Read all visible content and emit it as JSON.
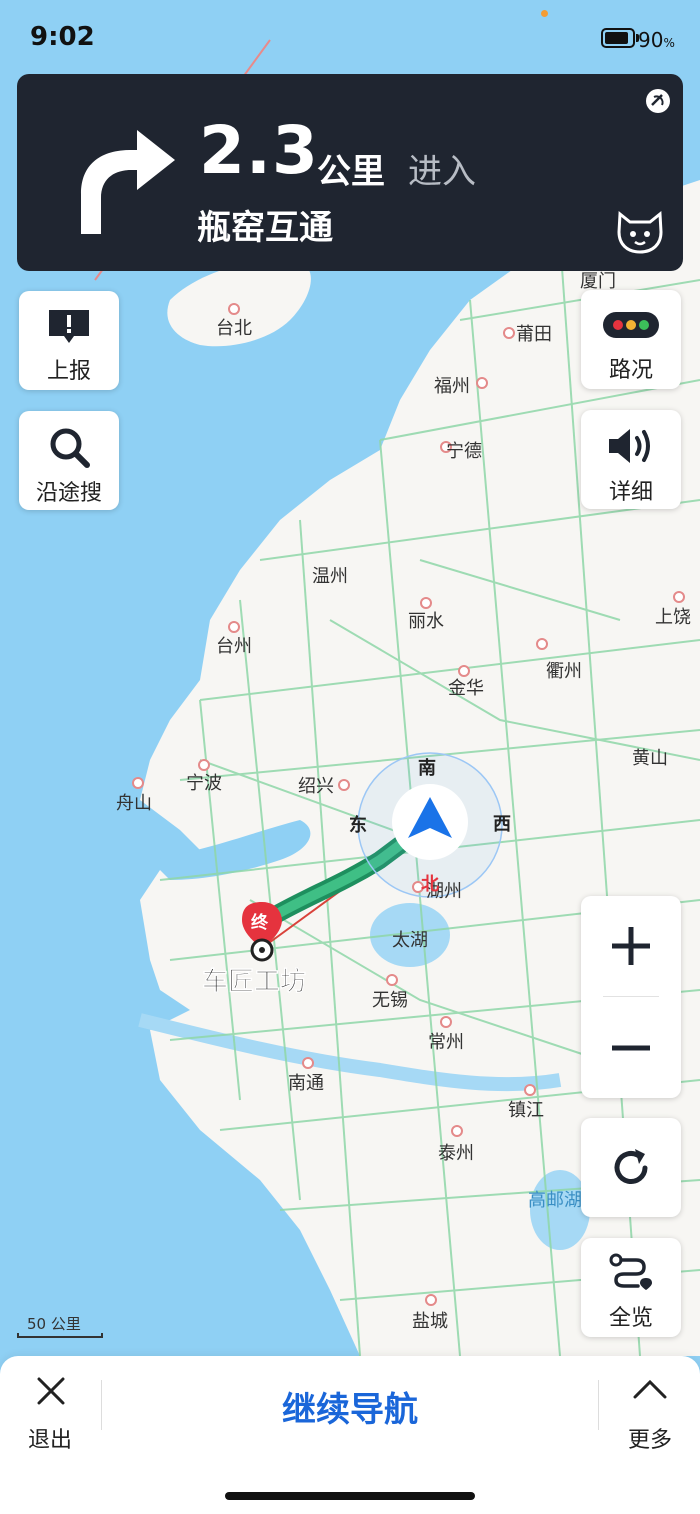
{
  "status_bar": {
    "time": "9:02",
    "battery_percent": "90",
    "battery_unit": "%",
    "battery_level": 0.9
  },
  "guidance": {
    "distance": "2.3",
    "unit": "公里",
    "action": "进入",
    "road": "瓶窑互通",
    "icons": {
      "turn": "turn-right-arrow-icon",
      "gps": "gps-signal-icon",
      "assistant": "mascot-icon"
    }
  },
  "controls": {
    "report": {
      "label": "上报",
      "icon": "report-icon"
    },
    "search_along": {
      "label": "沿途搜",
      "icon": "search-icon"
    },
    "traffic": {
      "label": "路况",
      "icon": "traffic-light-icon"
    },
    "voice": {
      "label": "详细",
      "icon": "speaker-icon"
    },
    "zoom_in_icon": "plus-icon",
    "zoom_out_icon": "minus-icon",
    "refresh_icon": "refresh-icon",
    "overview": {
      "label": "全览",
      "icon": "route-overview-icon"
    }
  },
  "map": {
    "destination_badge": "终",
    "destination_name": "车匠工坊",
    "compass": {
      "north": "北",
      "south": "南",
      "east": "东",
      "west": "西"
    },
    "cities": {
      "taibei": "台北",
      "putian": "莆田",
      "xiamen": "厦门",
      "fuzhou": "福州",
      "ningde": "宁德",
      "wenzhou": "温州",
      "lishui": "丽水",
      "taizhou_zj": "台州",
      "jinhua": "金华",
      "quzhou": "衢州",
      "shangrao": "上饶",
      "ningbo": "宁波",
      "shaoxing": "绍兴",
      "zhoushan": "舟山",
      "huangshan": "黄山",
      "huzhou": "湖州",
      "taihu": "太湖",
      "wuxi": "无锡",
      "changzhou": "常州",
      "nantong": "南通",
      "zhenjiang": "镇江",
      "taizhou_js": "泰州",
      "gaoyou": "高邮湖",
      "yancheng": "盐城"
    },
    "scale_label": "50 公里"
  },
  "bottom_bar": {
    "exit_label": "退出",
    "continue_label": "继续导航",
    "more_label": "更多"
  },
  "colors": {
    "sea": "#8fd0f4",
    "land": "#f7f6f3",
    "road": "#7fcf9a",
    "route": "#2a9a6a",
    "panel": "#1f2530",
    "accent": "#1a66d9",
    "marker": "#e5333e"
  }
}
